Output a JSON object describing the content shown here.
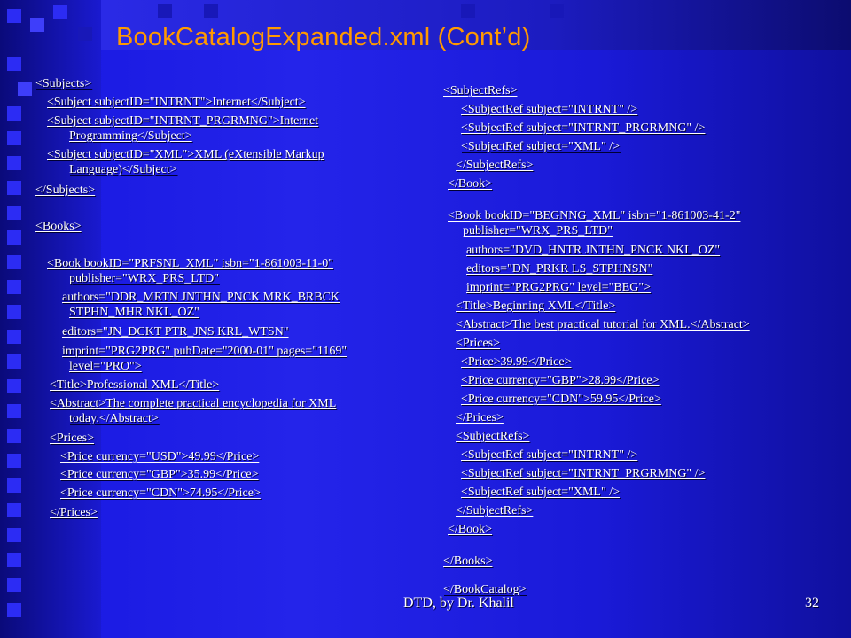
{
  "slide": {
    "title": "BookCatalogExpanded.xml  (Cont’d)",
    "footer": "DTD, by Dr. Khalil",
    "page_number": "32"
  },
  "left_column": [
    "<Subjects>",
    "<Subject subjectID=\"INTRNT\">Internet</Subject>",
    "<Subject subjectID=\"INTRNT_PRGRMNG\">Internet",
    "Programming</Subject>",
    "<Subject subjectID=\"XML\">XML (eXtensible Markup",
    "Language)</Subject>",
    "</Subjects>",
    "<Books>",
    "<Book bookID=\"PRFSNL_XML\" isbn=\"1-861003-11-0\"",
    "publisher=\"WRX_PRS_LTD\"",
    "authors=\"DDR_MRTN JNTHN_PNCK MRK_BRBCK",
    "STPHN_MHR NKL_OZ\"",
    "editors=\"JN_DCKT PTR_JNS KRL_WTSN\"",
    "imprint=\"PRG2PRG\" pubDate=\"2000-01\" pages=\"1169\"",
    "level=\"PRO\">",
    "<Title>Professional XML</Title>",
    "<Abstract>The complete practical encyclopedia for XML",
    "today.</Abstract>",
    "<Prices>",
    "<Price currency=\"USD\">49.99</Price>",
    "<Price currency=\"GBP\">35.99</Price>",
    "<Price currency=\"CDN\">74.95</Price>",
    "</Prices>"
  ],
  "right_column": [
    "<SubjectRefs>",
    "<SubjectRef subject=\"INTRNT\" />",
    "<SubjectRef subject=\"INTRNT_PRGRMNG\" />",
    "<SubjectRef subject=\"XML\" />",
    "</SubjectRefs>",
    "</Book>",
    "<Book bookID=\"BEGNNG_XML\" isbn=\"1-861003-41-2\"",
    "publisher=\"WRX_PRS_LTD\"",
    "authors=\"DVD_HNTR JNTHN_PNCK NKL_OZ\"",
    "editors=\"DN_PRKR LS_STPHNSN\"",
    "imprint=\"PRG2PRG\" level=\"BEG\">",
    "<Title>Beginning XML</Title>",
    "<Abstract>The best practical tutorial for XML.</Abstract>",
    "<Prices>",
    "<Price>39.99</Price>",
    "<Price currency=\"GBP\">28.99</Price>",
    "<Price currency=\"CDN\">59.95</Price>",
    "</Prices>",
    "<SubjectRefs>",
    "<SubjectRef subject=\"INTRNT\" />",
    "<SubjectRef subject=\"INTRNT_PRGRMNG\" />",
    "<SubjectRef subject=\"XML\" />",
    "</SubjectRefs>",
    "</Book>",
    "</Books>",
    "</BookCatalog>"
  ],
  "colors": {
    "background": "#1f1fe6",
    "title": "#ff9900",
    "text": "#ffffff"
  }
}
